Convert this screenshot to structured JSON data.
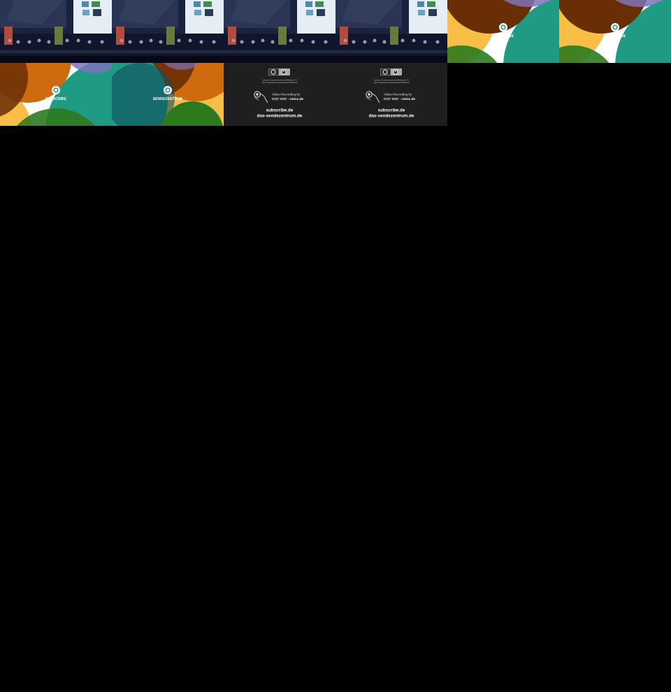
{
  "tiles": {
    "stage_1": {
      "kind": "stage-photo"
    },
    "stage_2": {
      "kind": "stage-photo"
    },
    "stage_3": {
      "kind": "stage-photo"
    },
    "stage_4": {
      "kind": "stage-photo"
    },
    "logo_1": {
      "label": "SUBSCRIBE"
    },
    "logo_2": {
      "label": "SUBSCRIBE"
    },
    "logo_3": {
      "label": "SUBSCRIBE"
    },
    "logo_4": {
      "label": "SENDEZENTRUM"
    },
    "credits": {
      "license_line_1": "License: Creative Commons Attribution 4.0",
      "license_line_2": "https://creativecommons.org/licenses/by/4.0/",
      "recording_label": "Video-Recording by",
      "recording_by": "CCC VOC - c3voc.de",
      "site_1": "subscribe.de",
      "site_2": "das-sendezentrum.de"
    }
  },
  "colors": {
    "background": "#000000",
    "credit_background": "#1f1f1f",
    "teal": "#1f9a83",
    "dark_brown": "#6a2e06",
    "orange": "#cf6b0e",
    "yellow": "#f8be45",
    "green": "#2d7a1e",
    "purple": "#7e72b8",
    "stage_blue": "#1a2240"
  }
}
